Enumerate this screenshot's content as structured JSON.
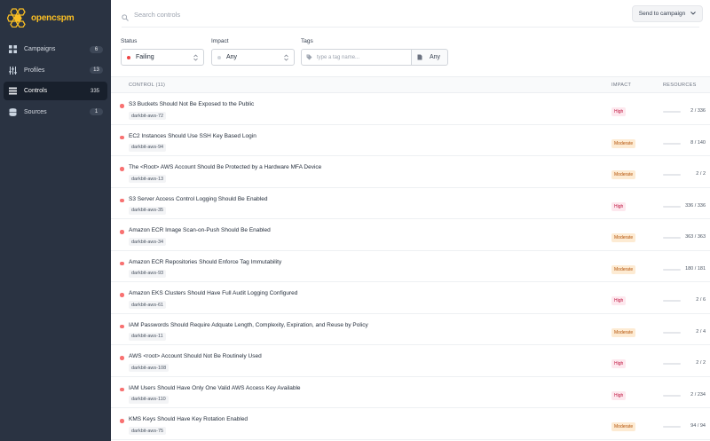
{
  "app": {
    "logo_text": "opencspm"
  },
  "sidebar": {
    "items": [
      {
        "label": "Campaigns",
        "count": "6",
        "icon": "grid-icon",
        "active": false
      },
      {
        "label": "Profiles",
        "count": "13",
        "icon": "sliders-icon",
        "active": false
      },
      {
        "label": "Controls",
        "count": "335",
        "icon": "list-icon",
        "active": true
      },
      {
        "label": "Sources",
        "count": "1",
        "icon": "database-icon",
        "active": false
      }
    ]
  },
  "topbar": {
    "search_placeholder": "Search controls",
    "campaign_button": "Send to campaign"
  },
  "filters": {
    "status": {
      "label": "Status",
      "value": "Failing",
      "dot_color": "#ef4444"
    },
    "impact": {
      "label": "Impact",
      "value": "Any",
      "dot_color": "#d1d5db"
    },
    "tags": {
      "label": "Tags",
      "placeholder": "type a tag name...",
      "any": "Any"
    }
  },
  "table": {
    "headers": {
      "control": "CONTROL (11)",
      "impact": "IMPACT",
      "resources": "RESOURCES"
    },
    "rows": [
      {
        "title": "S3 Buckets Should Not Be Exposed to the Public",
        "tag": "darkbit-aws-72",
        "impact": "High",
        "resources": "2 / 336",
        "progress": 0.01
      },
      {
        "title": "EC2 Instances Should Use SSH Key Based Login",
        "tag": "darkbit-aws-94",
        "impact": "Moderate",
        "resources": "8 / 140",
        "progress": 0.06
      },
      {
        "title": "The <Root> AWS Account Should Be Protected by a Hardware MFA Device",
        "tag": "darkbit-aws-13",
        "impact": "Moderate",
        "resources": "2 / 2",
        "progress": 1.0
      },
      {
        "title": "S3 Server Access Control Logging Should Be Enabled",
        "tag": "darkbit-aws-35",
        "impact": "High",
        "resources": "336 / 336",
        "progress": 1.0
      },
      {
        "title": "Amazon ECR Image Scan-on-Push Should Be Enabled",
        "tag": "darkbit-aws-34",
        "impact": "Moderate",
        "resources": "363 / 363",
        "progress": 1.0
      },
      {
        "title": "Amazon ECR Repositories Should Enforce Tag Immutability",
        "tag": "darkbit-aws-93",
        "impact": "Moderate",
        "resources": "180 / 181",
        "progress": 0.99
      },
      {
        "title": "Amazon EKS Clusters Should Have Full Audit Logging Configured",
        "tag": "darkbit-aws-61",
        "impact": "High",
        "resources": "2 / 6",
        "progress": 0.33
      },
      {
        "title": "IAM Passwords Should Require Adquate Length, Complexity, Expiration, and Reuse by Policy",
        "tag": "darkbit-aws-11",
        "impact": "Moderate",
        "resources": "2 / 4",
        "progress": 0.5
      },
      {
        "title": "AWS <root> Account Should Not Be Routinely Used",
        "tag": "darkbit-aws-108",
        "impact": "High",
        "resources": "2 / 2",
        "progress": 1.0
      },
      {
        "title": "IAM Users Should Have Only One Valid AWS Access Key Available",
        "tag": "darkbit-aws-110",
        "impact": "High",
        "resources": "2 / 234",
        "progress": 0.01
      },
      {
        "title": "KMS Keys Should Have Key Rotation Enabled",
        "tag": "darkbit-aws-75",
        "impact": "Moderate",
        "resources": "94 / 94",
        "progress": 1.0
      }
    ]
  }
}
